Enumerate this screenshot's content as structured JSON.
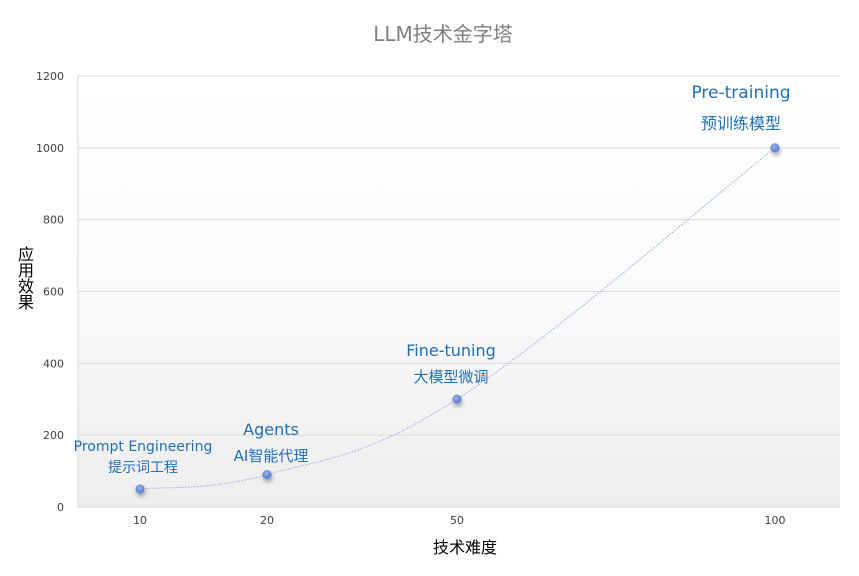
{
  "chart_data": {
    "type": "line",
    "title": "LLM技术金字塔",
    "xlabel": "技术难度",
    "ylabel": "应用效果",
    "categories": [
      "10",
      "20",
      "50",
      "100"
    ],
    "series": [
      {
        "values": [
          50,
          90,
          300,
          1000
        ]
      }
    ],
    "point_labels": [
      {
        "en": "Prompt Engineering",
        "zh": "提示词工程"
      },
      {
        "en": "Agents",
        "zh": "AI智能代理"
      },
      {
        "en": "Fine-tuning",
        "zh": "大模型微调"
      },
      {
        "en": "Pre-training",
        "zh": "预训练模型"
      }
    ],
    "y_ticks": [
      0,
      200,
      400,
      600,
      800,
      1000,
      1200
    ],
    "ylim": [
      0,
      1200
    ],
    "grid": true,
    "colors": {
      "line": "#8fa8e0",
      "marker": "#5b7fd6",
      "label": "#1f6fb5"
    }
  }
}
